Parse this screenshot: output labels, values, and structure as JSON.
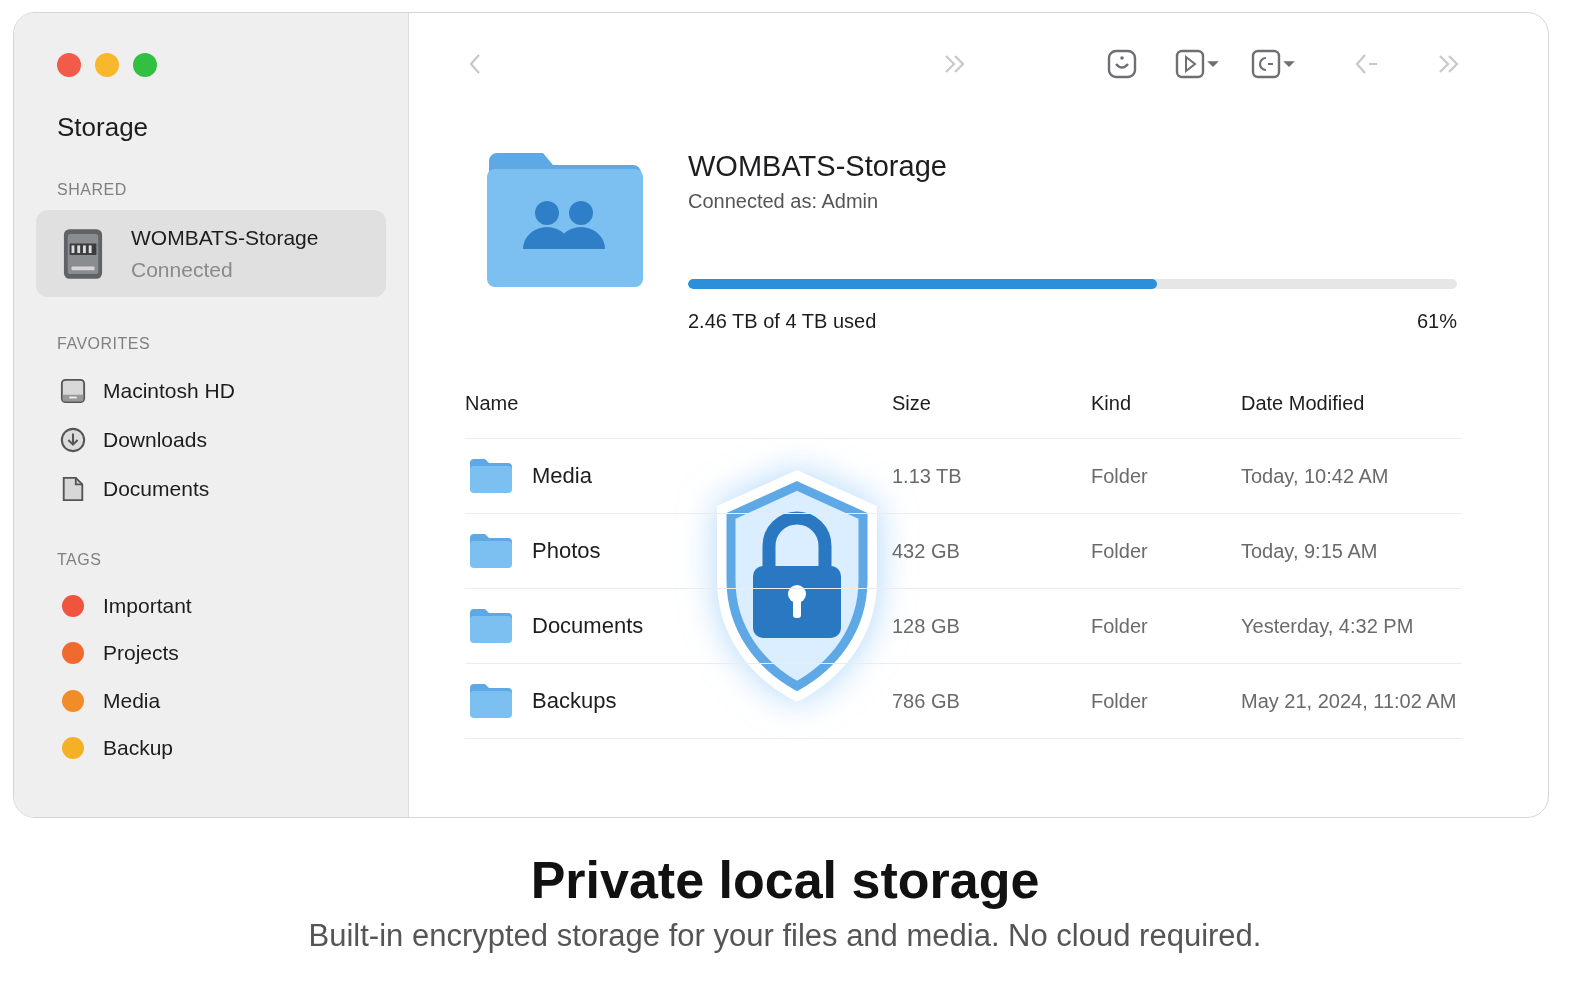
{
  "sidebar": {
    "title": "Storage",
    "sections": [
      {
        "heading": "SHARED",
        "items": [
          {
            "kind": "server",
            "label": "WOMBATS-Storage",
            "sublabel": "Connected",
            "selected": true
          }
        ]
      },
      {
        "heading": "FAVORITES",
        "items": [
          {
            "kind": "disk",
            "label": "Macintosh HD",
            "selected": false
          },
          {
            "kind": "downloads",
            "label": "Downloads",
            "selected": false
          },
          {
            "kind": "document",
            "label": "Documents",
            "selected": false
          }
        ]
      },
      {
        "heading": "TAGS",
        "items": [
          {
            "kind": "tag",
            "label": "Important",
            "color": "#f0543f",
            "selected": false
          },
          {
            "kind": "tag",
            "label": "Projects",
            "color": "#f06a30",
            "selected": false
          },
          {
            "kind": "tag",
            "label": "Media",
            "color": "#f28c28",
            "selected": false
          },
          {
            "kind": "tag",
            "label": "Backup",
            "color": "#f5b125",
            "selected": false
          }
        ]
      }
    ]
  },
  "toolbar": [
    {
      "kind": "back",
      "disabled": true
    },
    {
      "kind": "skip",
      "disabled": true
    },
    {
      "kind": "face",
      "disabled": false
    },
    {
      "kind": "play",
      "disabled": false
    },
    {
      "kind": "code",
      "disabled": false
    },
    {
      "kind": "arrow-back",
      "disabled": true
    },
    {
      "kind": "skip",
      "disabled": true
    }
  ],
  "volume": {
    "name": "WOMBATS-Storage",
    "connection": "Connected as: Admin",
    "level": 0.61,
    "usage": "2.46 TB of 4 TB used",
    "percent": "61%"
  },
  "table": {
    "columns": [
      "Name",
      "Size",
      "Kind",
      "Date Modified"
    ],
    "rows": [
      {
        "name": "Media",
        "size": "1.13 TB",
        "kind": "Folder",
        "modified": "Today, 10:42 AM"
      },
      {
        "name": "Photos",
        "size": "432 GB",
        "kind": "Folder",
        "modified": "Today, 9:15 AM"
      },
      {
        "name": "Documents",
        "size": "128 GB",
        "kind": "Folder",
        "modified": "Yesterday, 4:32 PM"
      },
      {
        "name": "Backups",
        "size": "786 GB",
        "kind": "Folder",
        "modified": "May 21, 2024, 11:02 AM"
      }
    ]
  },
  "caption": {
    "title": "Private local storage",
    "subtitle": "Built-in encrypted storage for your files and media. No cloud required."
  }
}
